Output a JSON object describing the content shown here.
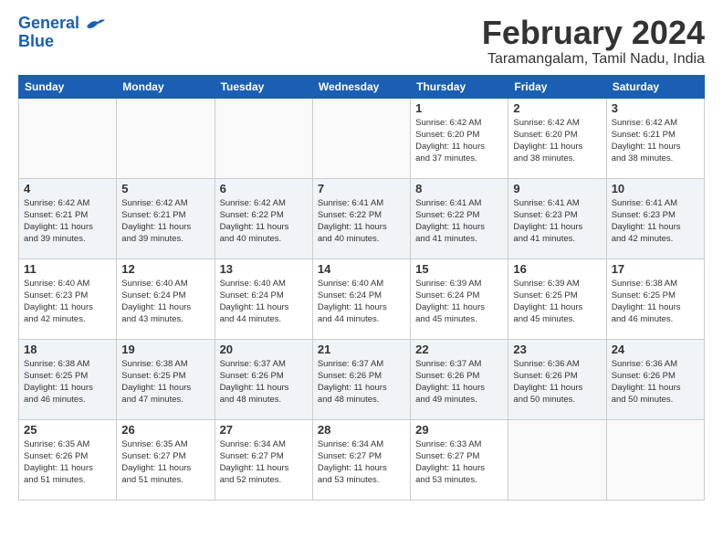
{
  "logo": {
    "line1": "General",
    "line2": "Blue"
  },
  "title": "February 2024",
  "subtitle": "Taramangalam, Tamil Nadu, India",
  "weekdays": [
    "Sunday",
    "Monday",
    "Tuesday",
    "Wednesday",
    "Thursday",
    "Friday",
    "Saturday"
  ],
  "weeks": [
    [
      {
        "day": "",
        "info": ""
      },
      {
        "day": "",
        "info": ""
      },
      {
        "day": "",
        "info": ""
      },
      {
        "day": "",
        "info": ""
      },
      {
        "day": "1",
        "info": "Sunrise: 6:42 AM\nSunset: 6:20 PM\nDaylight: 11 hours\nand 37 minutes."
      },
      {
        "day": "2",
        "info": "Sunrise: 6:42 AM\nSunset: 6:20 PM\nDaylight: 11 hours\nand 38 minutes."
      },
      {
        "day": "3",
        "info": "Sunrise: 6:42 AM\nSunset: 6:21 PM\nDaylight: 11 hours\nand 38 minutes."
      }
    ],
    [
      {
        "day": "4",
        "info": "Sunrise: 6:42 AM\nSunset: 6:21 PM\nDaylight: 11 hours\nand 39 minutes."
      },
      {
        "day": "5",
        "info": "Sunrise: 6:42 AM\nSunset: 6:21 PM\nDaylight: 11 hours\nand 39 minutes."
      },
      {
        "day": "6",
        "info": "Sunrise: 6:42 AM\nSunset: 6:22 PM\nDaylight: 11 hours\nand 40 minutes."
      },
      {
        "day": "7",
        "info": "Sunrise: 6:41 AM\nSunset: 6:22 PM\nDaylight: 11 hours\nand 40 minutes."
      },
      {
        "day": "8",
        "info": "Sunrise: 6:41 AM\nSunset: 6:22 PM\nDaylight: 11 hours\nand 41 minutes."
      },
      {
        "day": "9",
        "info": "Sunrise: 6:41 AM\nSunset: 6:23 PM\nDaylight: 11 hours\nand 41 minutes."
      },
      {
        "day": "10",
        "info": "Sunrise: 6:41 AM\nSunset: 6:23 PM\nDaylight: 11 hours\nand 42 minutes."
      }
    ],
    [
      {
        "day": "11",
        "info": "Sunrise: 6:40 AM\nSunset: 6:23 PM\nDaylight: 11 hours\nand 42 minutes."
      },
      {
        "day": "12",
        "info": "Sunrise: 6:40 AM\nSunset: 6:24 PM\nDaylight: 11 hours\nand 43 minutes."
      },
      {
        "day": "13",
        "info": "Sunrise: 6:40 AM\nSunset: 6:24 PM\nDaylight: 11 hours\nand 44 minutes."
      },
      {
        "day": "14",
        "info": "Sunrise: 6:40 AM\nSunset: 6:24 PM\nDaylight: 11 hours\nand 44 minutes."
      },
      {
        "day": "15",
        "info": "Sunrise: 6:39 AM\nSunset: 6:24 PM\nDaylight: 11 hours\nand 45 minutes."
      },
      {
        "day": "16",
        "info": "Sunrise: 6:39 AM\nSunset: 6:25 PM\nDaylight: 11 hours\nand 45 minutes."
      },
      {
        "day": "17",
        "info": "Sunrise: 6:38 AM\nSunset: 6:25 PM\nDaylight: 11 hours\nand 46 minutes."
      }
    ],
    [
      {
        "day": "18",
        "info": "Sunrise: 6:38 AM\nSunset: 6:25 PM\nDaylight: 11 hours\nand 46 minutes."
      },
      {
        "day": "19",
        "info": "Sunrise: 6:38 AM\nSunset: 6:25 PM\nDaylight: 11 hours\nand 47 minutes."
      },
      {
        "day": "20",
        "info": "Sunrise: 6:37 AM\nSunset: 6:26 PM\nDaylight: 11 hours\nand 48 minutes."
      },
      {
        "day": "21",
        "info": "Sunrise: 6:37 AM\nSunset: 6:26 PM\nDaylight: 11 hours\nand 48 minutes."
      },
      {
        "day": "22",
        "info": "Sunrise: 6:37 AM\nSunset: 6:26 PM\nDaylight: 11 hours\nand 49 minutes."
      },
      {
        "day": "23",
        "info": "Sunrise: 6:36 AM\nSunset: 6:26 PM\nDaylight: 11 hours\nand 50 minutes."
      },
      {
        "day": "24",
        "info": "Sunrise: 6:36 AM\nSunset: 6:26 PM\nDaylight: 11 hours\nand 50 minutes."
      }
    ],
    [
      {
        "day": "25",
        "info": "Sunrise: 6:35 AM\nSunset: 6:26 PM\nDaylight: 11 hours\nand 51 minutes."
      },
      {
        "day": "26",
        "info": "Sunrise: 6:35 AM\nSunset: 6:27 PM\nDaylight: 11 hours\nand 51 minutes."
      },
      {
        "day": "27",
        "info": "Sunrise: 6:34 AM\nSunset: 6:27 PM\nDaylight: 11 hours\nand 52 minutes."
      },
      {
        "day": "28",
        "info": "Sunrise: 6:34 AM\nSunset: 6:27 PM\nDaylight: 11 hours\nand 53 minutes."
      },
      {
        "day": "29",
        "info": "Sunrise: 6:33 AM\nSunset: 6:27 PM\nDaylight: 11 hours\nand 53 minutes."
      },
      {
        "day": "",
        "info": ""
      },
      {
        "day": "",
        "info": ""
      }
    ]
  ]
}
